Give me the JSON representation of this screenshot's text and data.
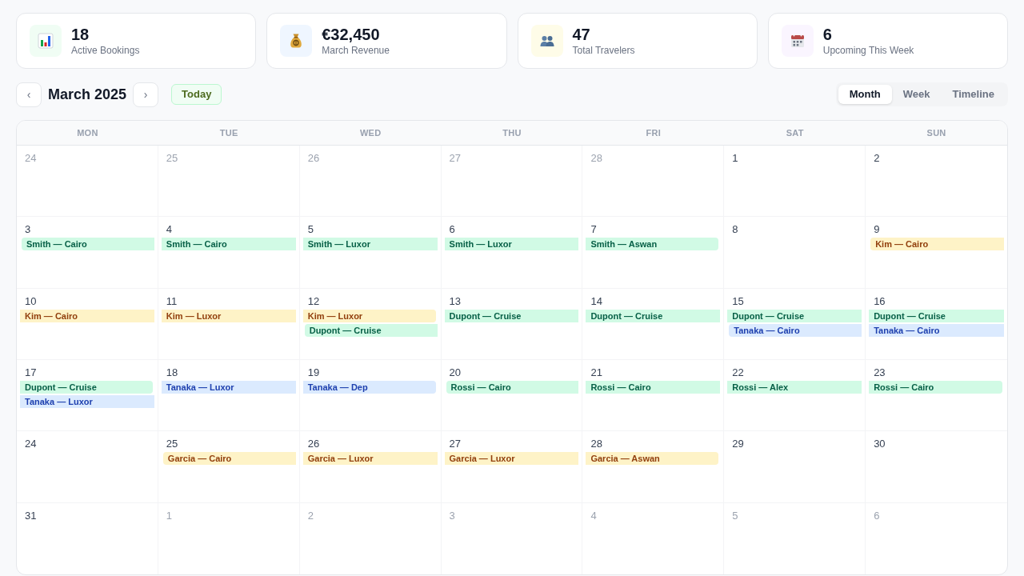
{
  "stats": [
    {
      "kind": "bookings",
      "color": "#f0fdf4",
      "value": "18",
      "label": "Active Bookings"
    },
    {
      "kind": "revenue",
      "color": "#eff6ff",
      "value": "€32,450",
      "label": "March Revenue"
    },
    {
      "kind": "travelers",
      "color": "#fefce8",
      "value": "47",
      "label": "Total Travelers"
    },
    {
      "kind": "upcoming",
      "color": "#faf5ff",
      "value": "6",
      "label": "Upcoming This Week"
    }
  ],
  "toolbar": {
    "prev": "‹",
    "title": "March 2025",
    "next": "›",
    "today": "Today"
  },
  "views": [
    {
      "label": "Month",
      "selected": true
    },
    {
      "label": "Week",
      "selected": false
    },
    {
      "label": "Timeline",
      "selected": false
    }
  ],
  "calendar": {
    "weekdays": [
      "MON",
      "TUE",
      "WED",
      "THU",
      "FRI",
      "SAT",
      "SUN"
    ],
    "weeks": [
      [
        {
          "day": "24",
          "outside": true
        },
        {
          "day": "25",
          "outside": true
        },
        {
          "day": "26",
          "outside": true
        },
        {
          "day": "27",
          "outside": true
        },
        {
          "day": "28",
          "outside": true
        },
        {
          "day": "1",
          "outside": false
        },
        {
          "day": "2",
          "outside": false
        }
      ],
      [
        {
          "day": "3",
          "outside": false,
          "events": [
            {
              "label": "Smith — Cairo",
              "color": "#d1fae5",
              "kind": "start"
            }
          ]
        },
        {
          "day": "4",
          "outside": false,
          "events": [
            {
              "label": "Smith — Cairo",
              "color": "#d1fae5",
              "kind": "middle"
            }
          ]
        },
        {
          "day": "5",
          "outside": false,
          "events": [
            {
              "label": "Smith — Luxor",
              "color": "#d1fae5",
              "kind": "middle"
            }
          ]
        },
        {
          "day": "6",
          "outside": false,
          "events": [
            {
              "label": "Smith — Luxor",
              "color": "#d1fae5",
              "kind": "middle"
            }
          ]
        },
        {
          "day": "7",
          "outside": false,
          "events": [
            {
              "label": "Smith — Aswan",
              "color": "#d1fae5",
              "kind": "end"
            }
          ]
        },
        {
          "day": "8",
          "outside": false
        },
        {
          "day": "9",
          "outside": false,
          "events": [
            {
              "label": "Kim — Cairo",
              "color": "#fef3c7",
              "kind": "start"
            }
          ]
        }
      ],
      [
        {
          "day": "10",
          "outside": false,
          "events": [
            {
              "label": "Kim — Cairo",
              "color": "#fef3c7",
              "kind": "middle"
            }
          ]
        },
        {
          "day": "11",
          "outside": false,
          "events": [
            {
              "label": "Kim — Luxor",
              "color": "#fef3c7",
              "kind": "middle"
            }
          ]
        },
        {
          "day": "12",
          "outside": false,
          "events": [
            {
              "label": "Kim — Luxor",
              "color": "#fef3c7",
              "kind": "end"
            },
            {
              "label": "Dupont — Cruise",
              "color": "#d1fae5",
              "kind": "start"
            }
          ]
        },
        {
          "day": "13",
          "outside": false,
          "events": [
            {
              "label": "Dupont — Cruise",
              "color": "#d1fae5",
              "kind": "middle"
            }
          ]
        },
        {
          "day": "14",
          "outside": false,
          "events": [
            {
              "label": "Dupont — Cruise",
              "color": "#d1fae5",
              "kind": "middle"
            }
          ]
        },
        {
          "day": "15",
          "outside": false,
          "events": [
            {
              "label": "Dupont — Cruise",
              "color": "#d1fae5",
              "kind": "middle"
            },
            {
              "label": "Tanaka — Cairo",
              "color": "#dbeafe",
              "kind": "start"
            }
          ]
        },
        {
          "day": "16",
          "outside": false,
          "events": [
            {
              "label": "Dupont — Cruise",
              "color": "#d1fae5",
              "kind": "middle"
            },
            {
              "label": "Tanaka — Cairo",
              "color": "#dbeafe",
              "kind": "middle"
            }
          ]
        }
      ],
      [
        {
          "day": "17",
          "outside": false,
          "events": [
            {
              "label": "Dupont — Cruise",
              "color": "#d1fae5",
              "kind": "end"
            },
            {
              "label": "Tanaka — Luxor",
              "color": "#dbeafe",
              "kind": "middle"
            }
          ]
        },
        {
          "day": "18",
          "outside": false,
          "events": [
            {
              "label": "Tanaka — Luxor",
              "color": "#dbeafe",
              "kind": "middle"
            }
          ]
        },
        {
          "day": "19",
          "outside": false,
          "events": [
            {
              "label": "Tanaka — Dep",
              "color": "#dbeafe",
              "kind": "end"
            }
          ]
        },
        {
          "day": "20",
          "outside": false,
          "events": [
            {
              "label": "Rossi — Cairo",
              "color": "#d1fae5",
              "kind": "start"
            }
          ]
        },
        {
          "day": "21",
          "outside": false,
          "events": [
            {
              "label": "Rossi — Cairo",
              "color": "#d1fae5",
              "kind": "middle"
            }
          ]
        },
        {
          "day": "22",
          "outside": false,
          "events": [
            {
              "label": "Rossi — Alex",
              "color": "#d1fae5",
              "kind": "middle"
            }
          ]
        },
        {
          "day": "23",
          "outside": false,
          "events": [
            {
              "label": "Rossi — Cairo",
              "color": "#d1fae5",
              "kind": "end"
            }
          ]
        }
      ],
      [
        {
          "day": "24",
          "outside": false
        },
        {
          "day": "25",
          "outside": false,
          "events": [
            {
              "label": "Garcia — Cairo",
              "color": "#fef3c7",
              "kind": "start"
            }
          ]
        },
        {
          "day": "26",
          "outside": false,
          "events": [
            {
              "label": "Garcia — Luxor",
              "color": "#fef3c7",
              "kind": "middle"
            }
          ]
        },
        {
          "day": "27",
          "outside": false,
          "events": [
            {
              "label": "Garcia — Luxor",
              "color": "#fef3c7",
              "kind": "middle"
            }
          ]
        },
        {
          "day": "28",
          "outside": false,
          "events": [
            {
              "label": "Garcia — Aswan",
              "color": "#fef3c7",
              "kind": "end"
            }
          ]
        },
        {
          "day": "29",
          "outside": false
        },
        {
          "day": "30",
          "outside": false
        }
      ],
      [
        {
          "day": "31",
          "outside": false
        },
        {
          "day": "1",
          "outside": true
        },
        {
          "day": "2",
          "outside": true
        },
        {
          "day": "3",
          "outside": true
        },
        {
          "day": "4",
          "outside": true
        },
        {
          "day": "5",
          "outside": true
        },
        {
          "day": "6",
          "outside": true
        }
      ]
    ]
  }
}
